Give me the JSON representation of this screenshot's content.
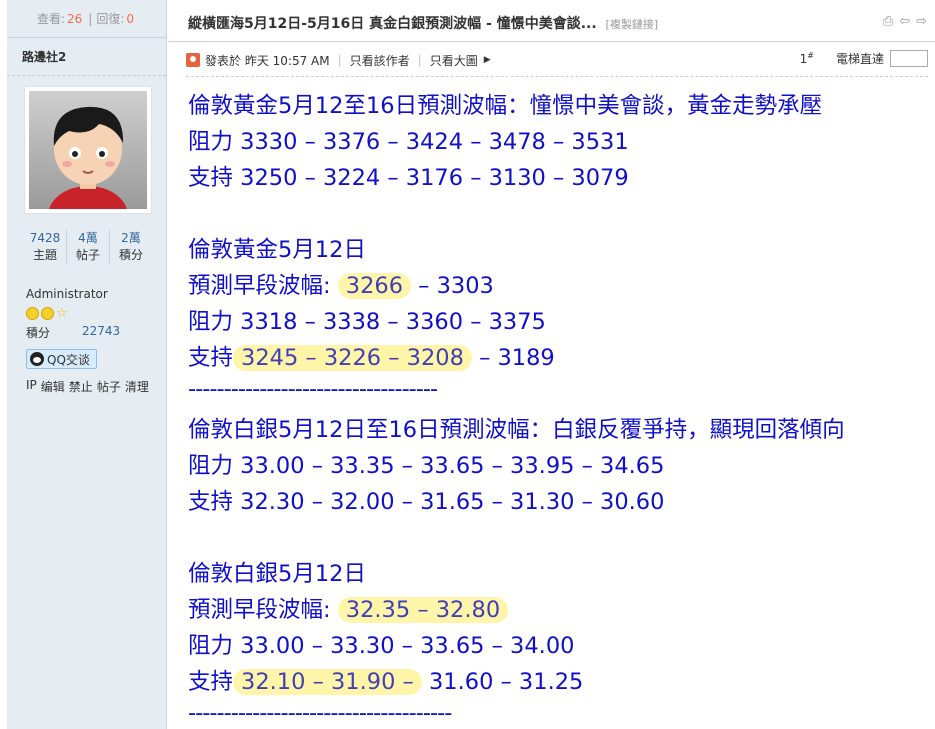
{
  "stats": {
    "views_label": "查看:",
    "views": "26",
    "replies_label": "回復:",
    "replies": "0"
  },
  "thread": {
    "title": "縱橫匯海5月12日-5月16日 真金白銀預測波幅 - 憧憬中美會談...",
    "copy_link": "[複製鏈接]"
  },
  "author": {
    "name": "路邊社2",
    "stats": [
      {
        "value": "7428",
        "label": "主題"
      },
      {
        "value": "4萬",
        "label": "帖子"
      },
      {
        "value": "2萬",
        "label": "積分"
      }
    ],
    "role": "Administrator",
    "points_label": "積分",
    "points_value": "22743",
    "qq_label": "QQ交谈",
    "admin_links": [
      "IP",
      "编辑",
      "禁止",
      "帖子",
      "清理"
    ]
  },
  "meta": {
    "posted": "發表於 昨天 10:57 AM",
    "only_author": "只看該作者",
    "big_image": "只看大圖",
    "floor": "1",
    "floor_sup": "#",
    "jump_label": "電梯直達"
  },
  "post": {
    "gold_week_title": "倫敦黃金5月12至16日預測波幅：憧憬中美會談，黃金走勢承壓",
    "gold_week_res": "阻力 3330 – 3376 – 3424 – 3478 – 3531",
    "gold_week_sup": "支持 3250 – 3224 – 3176 – 3130 – 3079",
    "gold_day_title": "倫敦黃金5月12日",
    "gold_day_range_label": "預測早段波幅:",
    "gold_day_range_hl": "3266",
    "gold_day_range_rest": "– 3303",
    "gold_day_res": "阻力 3318 – 3338 – 3360 – 3375",
    "gold_day_sup_label": "支持",
    "gold_day_sup_hl": "3245 – 3226 – 3208",
    "gold_day_sup_rest": "– 3189",
    "divider1": "-----------------------------------",
    "silver_week_title": "倫敦白銀5月12日至16日預測波幅：白銀反覆爭持，顯現回落傾向",
    "silver_week_res": "阻力 33.00 – 33.35 – 33.65 – 33.95 – 34.65",
    "silver_week_sup": "支持 32.30 – 32.00 – 31.65 – 31.30 – 30.60",
    "silver_day_title": "倫敦白銀5月12日",
    "silver_day_range_label": "預測早段波幅:",
    "silver_day_range_hl": "32.35 – 32.80",
    "silver_day_res": "阻力 33.00 – 33.30 – 33.65 – 34.00",
    "silver_day_sup_label": "支持",
    "silver_day_sup_hl": "32.10 – 31.90 –",
    "silver_day_sup_rest": "31.60 – 31.25",
    "divider2": "-------------------------------------"
  }
}
